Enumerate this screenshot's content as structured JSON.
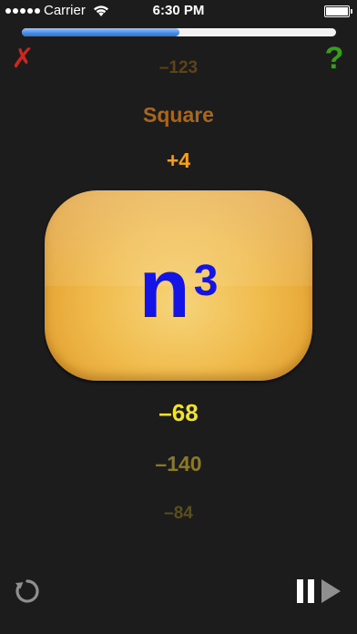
{
  "status_bar": {
    "carrier": "Carrier",
    "time": "6:30 PM",
    "signal_icon": "signal-dots-icon",
    "wifi_icon": "wifi-icon",
    "battery_icon": "battery-icon"
  },
  "progress": {
    "value_fraction": 0.5
  },
  "toolbar": {
    "close_icon": "close-icon",
    "close_glyph": "✗",
    "help_icon": "help-icon",
    "help_glyph": "?"
  },
  "options_above": [
    "–123",
    "Square",
    "+4"
  ],
  "card": {
    "base": "n",
    "exponent": "3"
  },
  "options_below": [
    "–68",
    "–140",
    "–84"
  ],
  "controls": {
    "restart_icon": "restart-icon",
    "pause_icon": "pause-icon",
    "play_icon": "play-icon"
  },
  "colors": {
    "background": "#1c1c1c",
    "card": "#f0bb4c",
    "expression": "#1414e6",
    "progress_fill": "#4a8ee8",
    "close": "#c8281f",
    "help": "#3a9c1c"
  }
}
